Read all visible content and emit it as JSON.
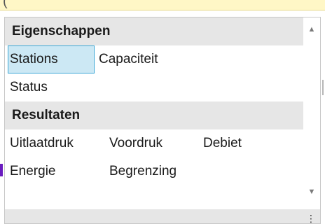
{
  "header_text": "(",
  "categories": [
    {
      "title": "Eigenschappen",
      "items": [
        "Stations",
        "Capaciteit",
        "Status"
      ]
    },
    {
      "title": "Resultaten",
      "items": [
        "Uitlaatdruk",
        "Voordruk",
        "Debiet",
        "Energie",
        "Begrenzing"
      ]
    }
  ],
  "selected_item": "Stations",
  "scroll_up_icon": "triangle-up-icon",
  "scroll_down_icon": "triangle-down-icon",
  "resize_grip_icon": "resize-grip-icon",
  "colors": {
    "category_header_bg": "#e6e6e6",
    "selection_bg": "#cce8f4",
    "selection_border": "#3ca7d6",
    "top_bar_bg": "#fff7c6",
    "left_mark": "#6a1bbf"
  }
}
